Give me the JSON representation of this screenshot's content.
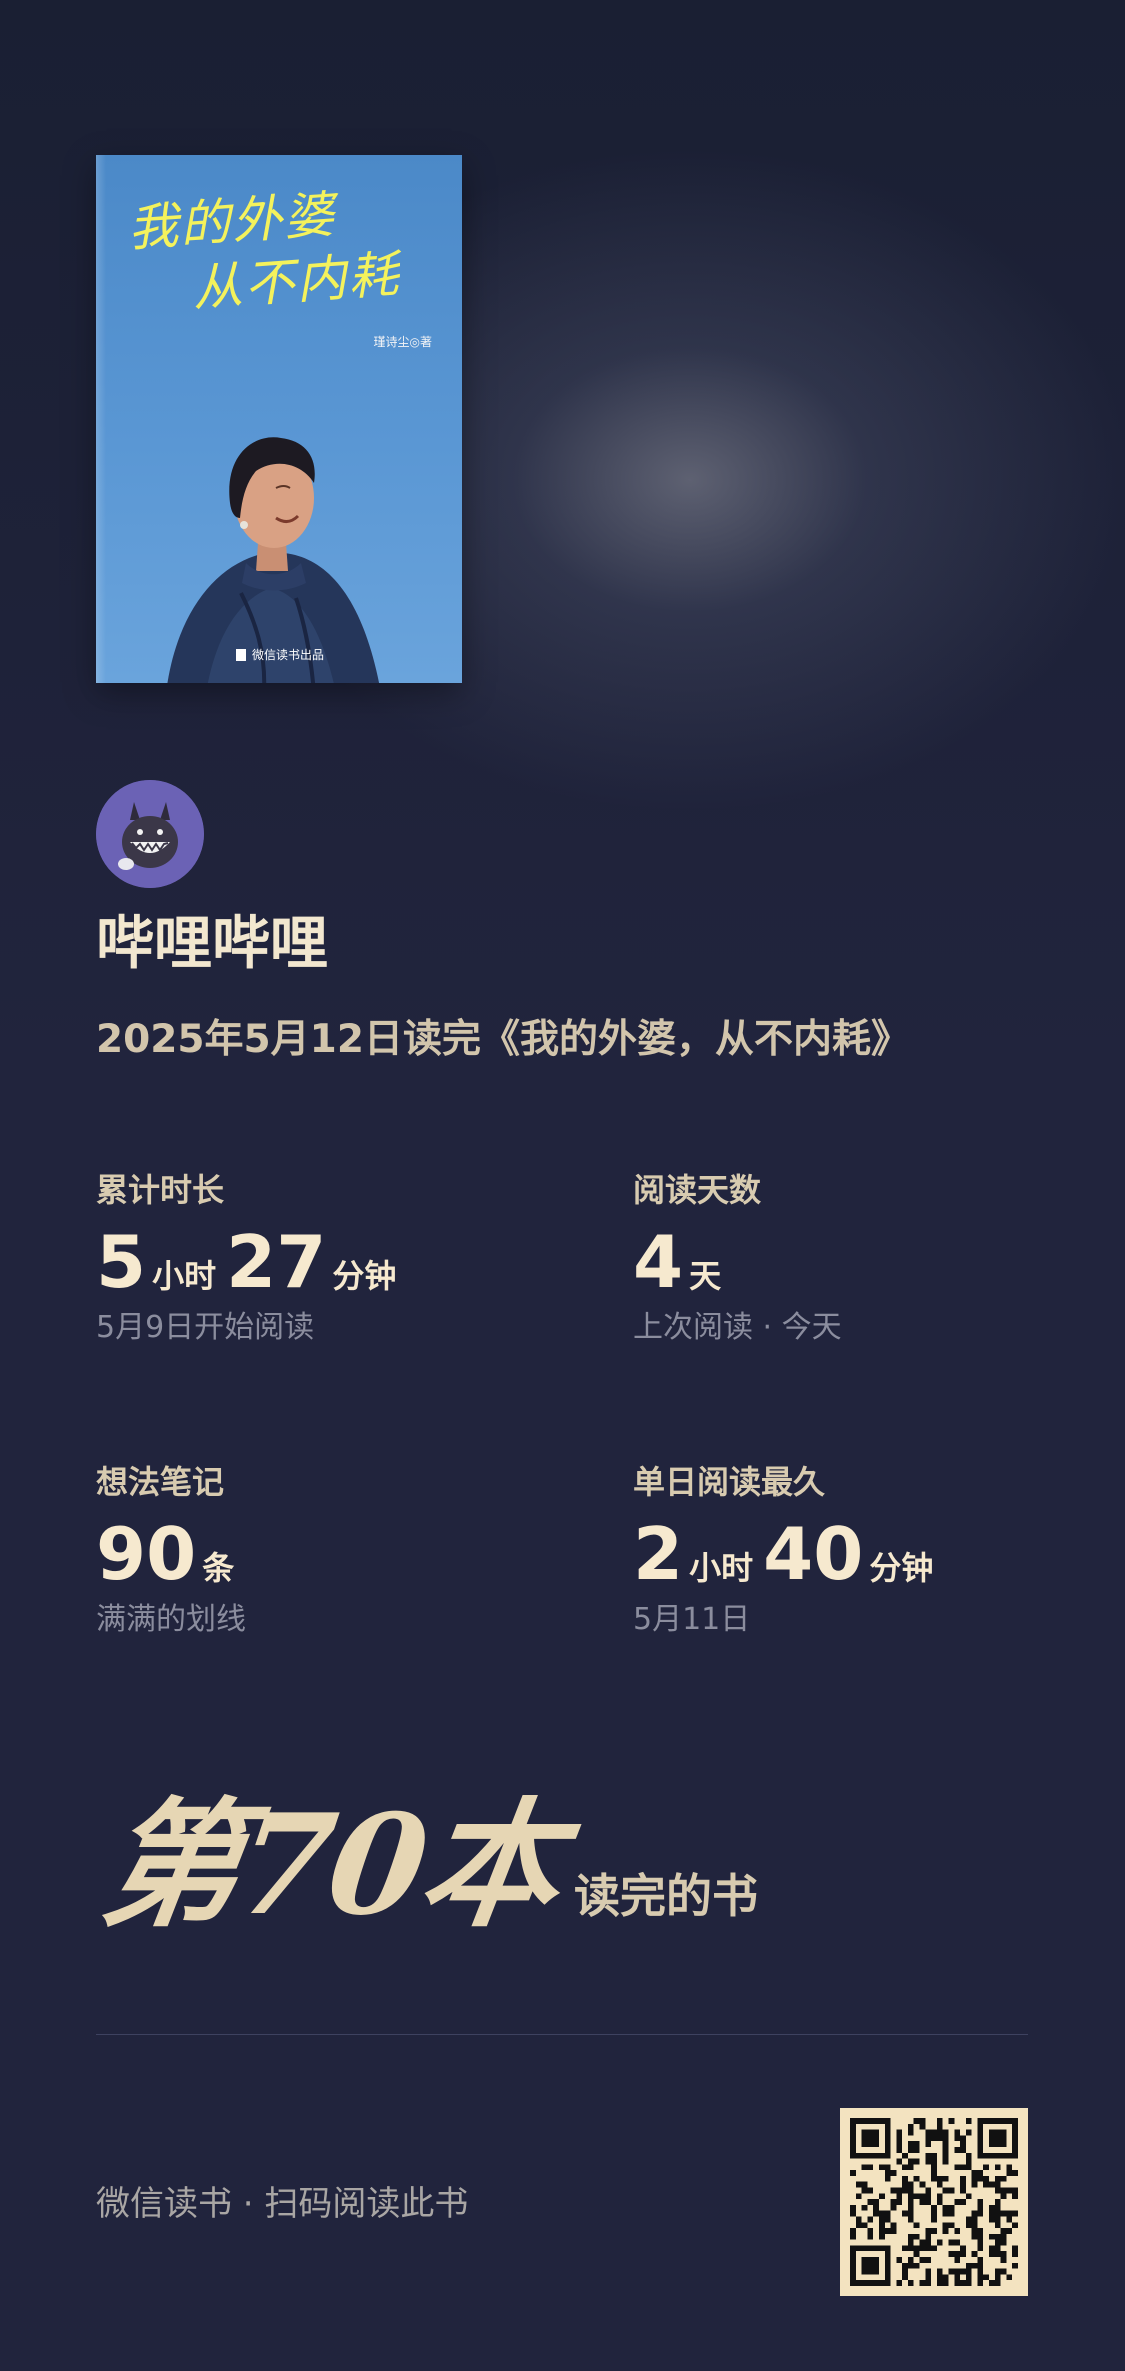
{
  "book": {
    "cover_title_line1": "我的外婆",
    "cover_title_line2": "从不内耗",
    "cover_author": "瑾诗尘◎著",
    "cover_publisher": "微信读书出品"
  },
  "user": {
    "name": "哔哩哔哩",
    "finish_line": "2025年5月12日读完《我的外婆，从不内耗》"
  },
  "stats": {
    "total_time": {
      "label": "累计时长",
      "hours": "5",
      "hours_unit": "小时",
      "minutes": "27",
      "minutes_unit": "分钟",
      "sub": "5月9日开始阅读"
    },
    "reading_days": {
      "label": "阅读天数",
      "value": "4",
      "unit": "天",
      "sub": "上次阅读 · 今天"
    },
    "notes": {
      "label": "想法笔记",
      "value": "90",
      "unit": "条",
      "sub": "满满的划线"
    },
    "longest_day": {
      "label": "单日阅读最久",
      "hours": "2",
      "hours_unit": "小时",
      "minutes": "40",
      "minutes_unit": "分钟",
      "sub": "5月11日"
    }
  },
  "rank": {
    "big": "第70本",
    "suffix": "读完的书"
  },
  "footer": {
    "text": "微信读书 · 扫码阅读此书"
  },
  "colors": {
    "background": "#21243d",
    "accent": "#f6e9cf",
    "muted": "#8b8d9e",
    "cover_blue": "#5a97d4",
    "cover_title_yellow": "#f4f25c"
  }
}
